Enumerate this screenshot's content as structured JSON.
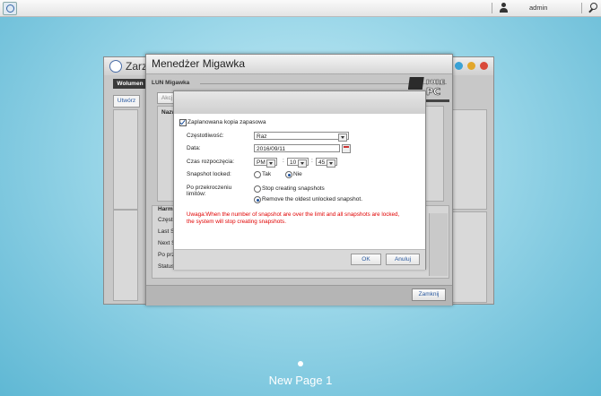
{
  "topbar": {
    "user": "admin"
  },
  "back_window": {
    "title": "Zarz",
    "tab": "Wolumen",
    "create_button": "Utwórz",
    "col_header": "Nazw",
    "section_title": "Harm",
    "rows": [
      "Często",
      "Last S",
      "Next S",
      "Po prz",
      "Status"
    ]
  },
  "main_window": {
    "title": "Menedżer Migawka",
    "section": "LUN Migawka",
    "toolbar_button": "Akcj",
    "col_header": "Nazw",
    "close_button": "Zamknij"
  },
  "dialog": {
    "scheduled_label": "Zaplanowana kopia zapasowa",
    "scheduled_checked": true,
    "frequency_label": "Częstotliwość:",
    "frequency_value": "Raz",
    "date_label": "Data:",
    "date_value": "2016/09/11",
    "start_time_label": "Czas rozpoczęcia:",
    "time_ampm": "PM",
    "time_hour": "10",
    "time_minute": "45",
    "time_sep1": ":",
    "time_sep2": ":",
    "snapshot_locked_label": "Snapshot locked:",
    "locked_yes": "Tak",
    "locked_no": "Nie",
    "limit_label_1": "Po przekroczeniu",
    "limit_label_2": "limitów:",
    "limit_option_1": "Stop creating snapshots",
    "limit_option_2": "Remove the oldest unlocked snapshot.",
    "warning_1": "Uwaga:When the number of snapshot are over the limit and all snapshots are locked,",
    "warning_2": "the system will stop creating snapshots.",
    "ok_button": "OK",
    "cancel_button": "Anuluj"
  },
  "page": {
    "label": "New Page 1"
  },
  "colors": {
    "warning": "#e00000",
    "accent": "#2a5aa0"
  }
}
